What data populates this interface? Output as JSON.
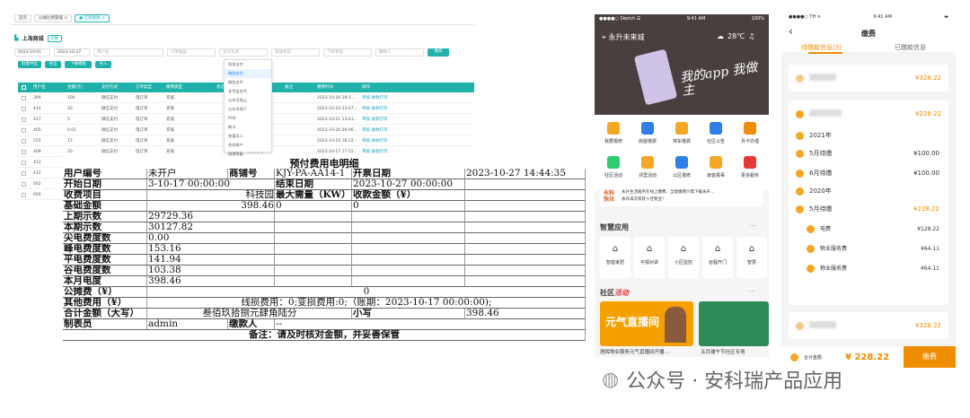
{
  "admin": {
    "tabs": [
      "首页",
      "公摊比例管理 ×",
      "● 订单收款 ×"
    ],
    "page_title": "上海商城",
    "title_btn": "切换",
    "filters": [
      "2023-10-01",
      "2023-10-27",
      "用户名",
      "订单类型",
      "支付方式",
      "发放状态",
      "下单状态",
      "缴款人"
    ],
    "search_label": "搜索",
    "toolbar": [
      "批量导出",
      "导出",
      "下载模板",
      "导入"
    ],
    "columns": [
      "用户名",
      "金额(元)",
      "支付方式",
      "订单类型",
      "缴费类型",
      "",
      "状态",
      "下单状态",
      "备注",
      "缴费时间",
      "操作"
    ],
    "rows": [
      [
        "309",
        "100",
        "微信支付",
        "电订单",
        "充值",
        "",
        "",
        "缴费成功",
        "",
        "2023-10-26 19:2...",
        "审核 收款打印"
      ],
      [
        "414",
        "20",
        "微信支付",
        "电订单",
        "充值",
        "",
        "",
        "缴费成功",
        "",
        "2023-10-24 23:47...",
        "审核 收款打印"
      ],
      [
        "417",
        "5",
        "微信支付",
        "电订单",
        "充值",
        "",
        "",
        "缴费成功",
        "",
        "2023-10-21 13:43...",
        "审核 收款打印"
      ],
      [
        "405",
        "0.01",
        "微信支付",
        "电订单",
        "充值",
        "",
        "",
        "缴费成功",
        "",
        "2023-10-20 09:06...",
        "审核 收款打印"
      ],
      [
        "555",
        "15",
        "微信支付",
        "电订单",
        "充值",
        "",
        "",
        "缴费成功",
        "",
        "2023-10-19 18:12...",
        "审核 收款打印"
      ],
      [
        "409",
        "20",
        "微信支付",
        "电订单",
        "充值",
        "",
        "",
        "缴费成功",
        "",
        "2023-10-17 17:52...",
        "审核 收款打印"
      ],
      [
        "412",
        "",
        "",
        "",
        "",
        "",
        "",
        "",
        "",
        "",
        ""
      ],
      [
        "412",
        "",
        "",
        "",
        "",
        "",
        "",
        "",
        "",
        "",
        ""
      ],
      [
        "602",
        "",
        "",
        "",
        "",
        "",
        "",
        "",
        "",
        "",
        ""
      ],
      [
        "600",
        "",
        "",
        "",
        "",
        "",
        "",
        "",
        "",
        "",
        ""
      ]
    ],
    "dropdown": [
      "现金支付",
      "微信支付",
      "微信支付",
      "支付宝支付",
      "公众号线上",
      "公众号线下",
      "POS",
      "刷卡",
      "充值导入",
      "合作商户",
      "线损等级"
    ],
    "dropdown_selected": 1
  },
  "receipt": {
    "title": "预付费用电明细",
    "r1": [
      "用户编号",
      "未开户",
      "商铺号",
      "KJY-PA-AA14-1",
      "开票日期",
      "2023-10-27 14:44:35"
    ],
    "r2": [
      "开始日期",
      "3-10-17 00:00:00",
      "结束日期",
      "2023-10-27 00:00:00"
    ],
    "r3": [
      "收费项目",
      "科技园",
      "最大需量（KW）",
      "收款金额（¥）"
    ],
    "r4": [
      "基础金额",
      "398.46",
      "0",
      "0"
    ],
    "rows": [
      [
        "上期示数",
        "29729.36"
      ],
      [
        "本期示数",
        "30127.82"
      ],
      [
        "尖电费度数",
        "0.00"
      ],
      [
        "峰电费度数",
        "153.16"
      ],
      [
        "平电费度数",
        "141.94"
      ],
      [
        "谷电费度数",
        "103.38"
      ],
      [
        "本月电度",
        "398.46"
      ]
    ],
    "gongtan": [
      "公摊费（¥）",
      "0"
    ],
    "qita": [
      "其他费用（¥）",
      "线损费用：0;变损费用:0;（账期：2023-10-17 00:00:00);"
    ],
    "total": [
      "合计金额（大写）",
      "叁佰玖拾捌元肆角陆分",
      "小写",
      "398.46"
    ],
    "maker": [
      "制表员",
      "admin",
      "缴款人",
      "--"
    ],
    "note": "备注：请及时核对金额，并妥善保管"
  },
  "phone1": {
    "status_left": "●●●●○ Sketch ☰",
    "status_time": "9:41 AM",
    "status_right": "100%",
    "location": "永升未来城",
    "weather": "28℃",
    "hero_text": "我的app 我做主",
    "grid": [
      "我要报修",
      "房屋缴费",
      "停车缴费",
      "社区公告",
      "月卡办理",
      "社区活动",
      "邻里活动",
      "公区报修",
      "家庭报事",
      "更多服务"
    ],
    "news_logo": "永科 快讯",
    "news": [
      "永升生活服务在线上缴费、全能缴费只需下载永升...",
      "永升再次荣获十佳物业！"
    ],
    "smart_title": "智慧应用",
    "smart": [
      "智能家居",
      "可视对讲",
      "小区监控",
      "远程开门",
      "智慧"
    ],
    "activity_title": "社区活动",
    "cards": [
      "旭辉物业服务元气直播间开播...",
      "五月端午节社区专场"
    ],
    "card_banner": "元气直播间"
  },
  "phone2": {
    "status_left": "●●●●○ TH ≋",
    "status_time": "9:41 AM",
    "title": "缴费",
    "tab_active": "待缴款信息(3)",
    "tab_inactive": "已缴款信息",
    "item1_amount": "¥328.22",
    "item2_amount": "¥228.22",
    "year2021": "2021年",
    "m5": "5月待缴",
    "m5v": "¥100.00",
    "m6": "6月待缴",
    "m6v": "¥100.00",
    "year2020": "2020年",
    "m5b": "5月待缴",
    "m5bv": "¥228.22",
    "subs": [
      [
        "电费",
        "¥128.22"
      ],
      [
        "物业服务费",
        "¥64.11"
      ],
      [
        "物业服务费",
        "¥64.11"
      ]
    ],
    "item3_amount": "¥328.22",
    "total_label": "合计金额",
    "total": "¥ 228.22",
    "pay": "缴费"
  },
  "watermark": "公众号 · 安科瑞产品应用"
}
